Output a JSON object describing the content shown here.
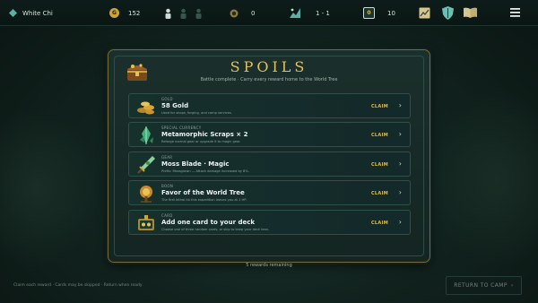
{
  "topbar": {
    "player_name": "White Chi",
    "gold": "152",
    "token_count": "0",
    "floor": "1 - 1",
    "cards": "10"
  },
  "panel": {
    "title": "SPOILS",
    "subtitle": "Battle complete · Carry every reward home to the World Tree"
  },
  "rewards": [
    {
      "category": "GOLD",
      "name": "58 Gold",
      "description": "Used for shops, forging, and camp services.",
      "action": "CLAIM",
      "icon": "coin-pile-icon"
    },
    {
      "category": "SPECIAL CURRENCY",
      "name": "Metamorphic Scraps × 2",
      "description": "Reforge normal gear or upgrade it to magic gear.",
      "action": "CLAIM",
      "icon": "crystal-scraps-icon"
    },
    {
      "category": "GEAR",
      "name": "Moss Blade · Magic",
      "description": "Prefix: Mossgrown — Attack damage increased by 8%.",
      "action": "CLAIM",
      "icon": "sword-icon"
    },
    {
      "category": "BOON",
      "name": "Favor of the World Tree",
      "description": "The first lethal hit this expedition leaves you at 1 HP.",
      "action": "CLAIM",
      "icon": "tree-boon-icon"
    },
    {
      "category": "CARD",
      "name": "Add one card to your deck",
      "description": "Choose one of three random cards, or skip to keep your deck lean.",
      "action": "CLAIM",
      "icon": "card-chest-icon"
    }
  ],
  "footer": {
    "remaining": "5 rewards remaining",
    "hint": "Claim each reward · Cards may be skipped · Return when ready",
    "return_label": "RETURN TO CAMP",
    "return_chevron": "›"
  },
  "colors": {
    "accent_gold": "#e5c257",
    "panel_bg": "#1b2f2c",
    "row_border": "#2f4f49"
  }
}
